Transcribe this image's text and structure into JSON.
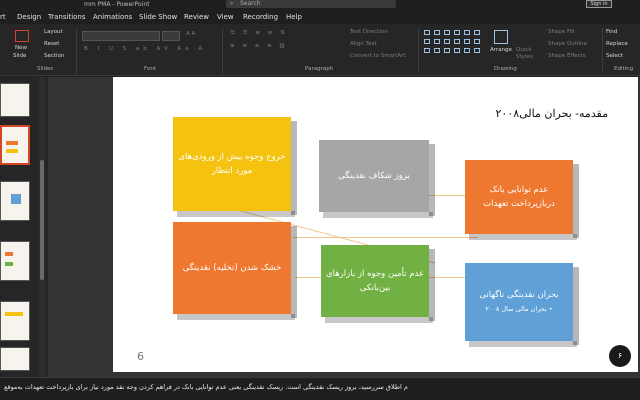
{
  "window": {
    "title": "mm PMA - PowerPoint",
    "search_placeholder": "Search",
    "signin": "Sign in"
  },
  "menu": [
    "rt",
    "Design",
    "Transitions",
    "Animations",
    "Slide Show",
    "Review",
    "View",
    "Recording",
    "Help"
  ],
  "ribbon": {
    "slides": {
      "label": "Slides",
      "new_slide": "New",
      "new_slide2": "Slide",
      "layout": "Layout",
      "reset": "Reset",
      "section": "Section"
    },
    "font": {
      "label": "Font"
    },
    "paragraph": {
      "label": "Paragraph",
      "text_direction": "Text Direction",
      "align_text": "Align Text",
      "convert_smartart": "Convert to SmartArt"
    },
    "drawing": {
      "label": "Drawing",
      "arrange": "Arrange",
      "quick": "Quick",
      "styles": "Styles",
      "shape_fill": "Shape Fill",
      "shape_outline": "Shape Outline",
      "shape_effects": "Shape Effects"
    },
    "editing": {
      "label": "Editing",
      "find": "Find",
      "replace": "Replace",
      "select": "Select"
    }
  },
  "slide": {
    "title": "مقدمه- بحران مالی۲۰۰۸",
    "blocks": {
      "outflow": "خروج وجوه بیش از ورودی‌های مورد انتظار",
      "gap": "بروز شکاف نقدینگی",
      "bank_inability": "عدم توانایی بانک دربازپرداخت تعهدات",
      "drying": "خشک شدن (تخلیه) نقدینگی",
      "no_funding": "عدم تأمین وجوه از بازارهای بین‌بانکی",
      "sudden_crisis": "بحران نقدینگی ناگهانی",
      "sudden_bullet": "بحران مالی سال ۲۰۰۸"
    },
    "num_left": "6",
    "num_right": "۶"
  },
  "notes": "م اطلاق سررسید، بروز ریسک نقدینگی است. ریسک نقدینگی یعنی عدم توانایی بانک در فراهم کردن وجه نقد مورد نیاز برای بازپرداخت تعهدات به‌موقع"
}
